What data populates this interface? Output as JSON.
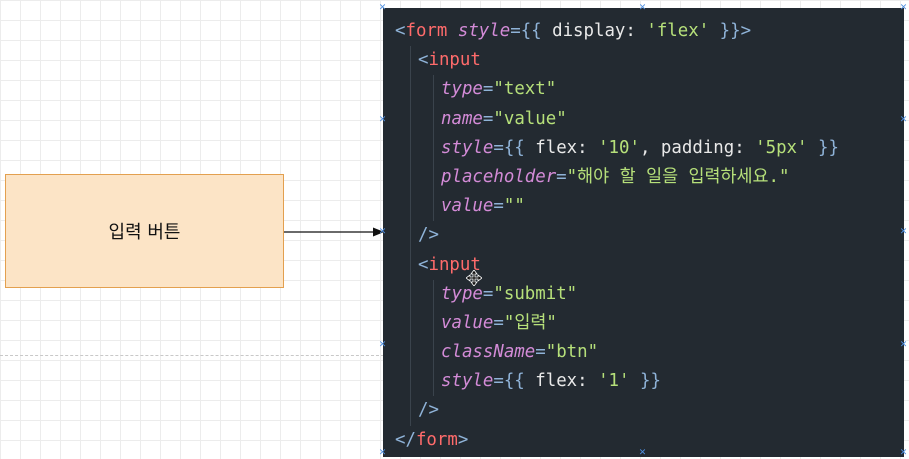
{
  "diagram": {
    "box_label": "입력 버튼"
  },
  "code": {
    "lines": [
      {
        "indent": 0,
        "tokens": [
          {
            "t": "punct",
            "v": "<"
          },
          {
            "t": "tag",
            "v": "form"
          },
          {
            "t": "plain",
            "v": " "
          },
          {
            "t": "attr",
            "v": "style"
          },
          {
            "t": "punct",
            "v": "={{"
          },
          {
            "t": "plain",
            "v": " display: "
          },
          {
            "t": "str",
            "v": "'flex'"
          },
          {
            "t": "plain",
            "v": " "
          },
          {
            "t": "punct",
            "v": "}}>"
          }
        ]
      },
      {
        "indent": 1,
        "tokens": [
          {
            "t": "punct",
            "v": "<"
          },
          {
            "t": "tag",
            "v": "input"
          }
        ]
      },
      {
        "indent": 2,
        "tokens": [
          {
            "t": "attr",
            "v": "type"
          },
          {
            "t": "punct",
            "v": "="
          },
          {
            "t": "str",
            "v": "\"text\""
          }
        ]
      },
      {
        "indent": 2,
        "tokens": [
          {
            "t": "attr",
            "v": "name"
          },
          {
            "t": "punct",
            "v": "="
          },
          {
            "t": "str",
            "v": "\"value\""
          }
        ]
      },
      {
        "indent": 2,
        "tokens": [
          {
            "t": "attr",
            "v": "style"
          },
          {
            "t": "punct",
            "v": "={{"
          },
          {
            "t": "plain",
            "v": " flex: "
          },
          {
            "t": "str",
            "v": "'10'"
          },
          {
            "t": "plain",
            "v": ", padding: "
          },
          {
            "t": "str",
            "v": "'5px'"
          },
          {
            "t": "plain",
            "v": " "
          },
          {
            "t": "punct",
            "v": "}}"
          }
        ]
      },
      {
        "indent": 2,
        "tokens": [
          {
            "t": "attr",
            "v": "placeholder"
          },
          {
            "t": "punct",
            "v": "="
          },
          {
            "t": "str",
            "v": "\"해야 할 일을 입력하세요.\""
          }
        ]
      },
      {
        "indent": 2,
        "tokens": [
          {
            "t": "attr",
            "v": "value"
          },
          {
            "t": "punct",
            "v": "="
          },
          {
            "t": "str",
            "v": "\"\""
          }
        ]
      },
      {
        "indent": 1,
        "tokens": [
          {
            "t": "punct",
            "v": "/>"
          }
        ]
      },
      {
        "indent": 1,
        "tokens": [
          {
            "t": "punct",
            "v": "<"
          },
          {
            "t": "tag",
            "v": "input"
          }
        ]
      },
      {
        "indent": 2,
        "tokens": [
          {
            "t": "attr",
            "v": "type"
          },
          {
            "t": "punct",
            "v": "="
          },
          {
            "t": "str",
            "v": "\"submit\""
          }
        ]
      },
      {
        "indent": 2,
        "tokens": [
          {
            "t": "attr",
            "v": "value"
          },
          {
            "t": "punct",
            "v": "="
          },
          {
            "t": "str",
            "v": "\"입력\""
          }
        ]
      },
      {
        "indent": 2,
        "tokens": [
          {
            "t": "attr",
            "v": "className"
          },
          {
            "t": "punct",
            "v": "="
          },
          {
            "t": "str",
            "v": "\"btn\""
          }
        ]
      },
      {
        "indent": 2,
        "tokens": [
          {
            "t": "attr",
            "v": "style"
          },
          {
            "t": "punct",
            "v": "={{"
          },
          {
            "t": "plain",
            "v": " flex: "
          },
          {
            "t": "str",
            "v": "'1'"
          },
          {
            "t": "plain",
            "v": " "
          },
          {
            "t": "punct",
            "v": "}}"
          }
        ]
      },
      {
        "indent": 1,
        "tokens": [
          {
            "t": "punct",
            "v": "/>"
          }
        ]
      },
      {
        "indent": 0,
        "tokens": [
          {
            "t": "punct",
            "v": "</"
          },
          {
            "t": "tag",
            "v": "form"
          },
          {
            "t": "punct",
            "v": ">"
          }
        ]
      }
    ]
  },
  "icons": {
    "cursor": "move-cursor-icon",
    "selection_handle": "selection-handle-icon"
  },
  "colors": {
    "box_fill": "#fce4c6",
    "box_border": "#e3a04f",
    "code_background": "#232a31",
    "tag": "#ff6b6b",
    "attribute": "#d38bd7",
    "string": "#b6e07a",
    "punctuation": "#8fb3d8",
    "selection_handle": "#4f8fe0"
  }
}
